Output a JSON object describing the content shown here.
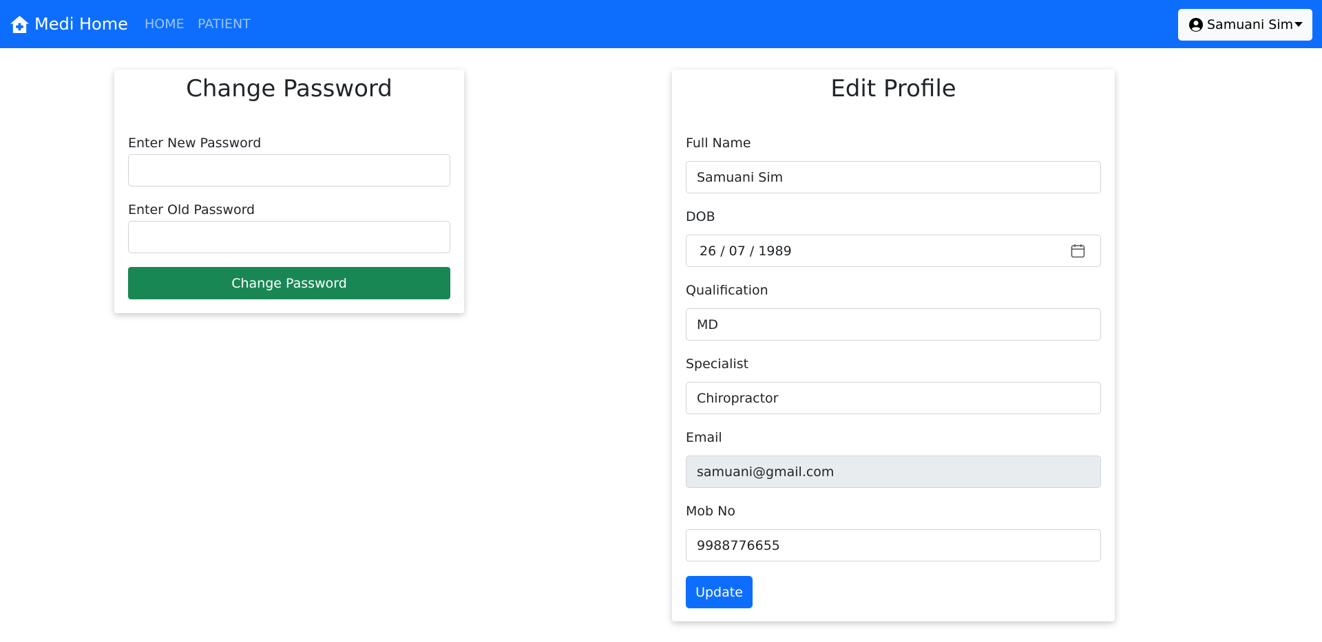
{
  "navbar": {
    "brand": "Medi Home",
    "brand_icon": "house-medical-icon",
    "links": [
      "HOME",
      "PATIENT"
    ],
    "user_name": "Samuani Sim",
    "user_icon": "user-circle-icon",
    "accent": "#0d6efd"
  },
  "change_password": {
    "title": "Change Password",
    "new_password_label": "Enter New Password",
    "new_password_value": "",
    "old_password_label": "Enter Old Password",
    "old_password_value": "",
    "submit_label": "Change Password",
    "submit_color": "#198754"
  },
  "edit_profile": {
    "title": "Edit Profile",
    "fields": {
      "full_name": {
        "label": "Full Name",
        "value": "Samuani Sim"
      },
      "dob": {
        "label": "DOB",
        "value": "26 / 07 / 1989"
      },
      "qualification": {
        "label": "Qualification",
        "value": "MD"
      },
      "specialist": {
        "label": "Specialist",
        "value": "Chiropractor"
      },
      "email": {
        "label": "Email",
        "value": "samuani@gmail.com"
      },
      "mob_no": {
        "label": "Mob No",
        "value": "9988776655"
      }
    },
    "submit_label": "Update"
  }
}
